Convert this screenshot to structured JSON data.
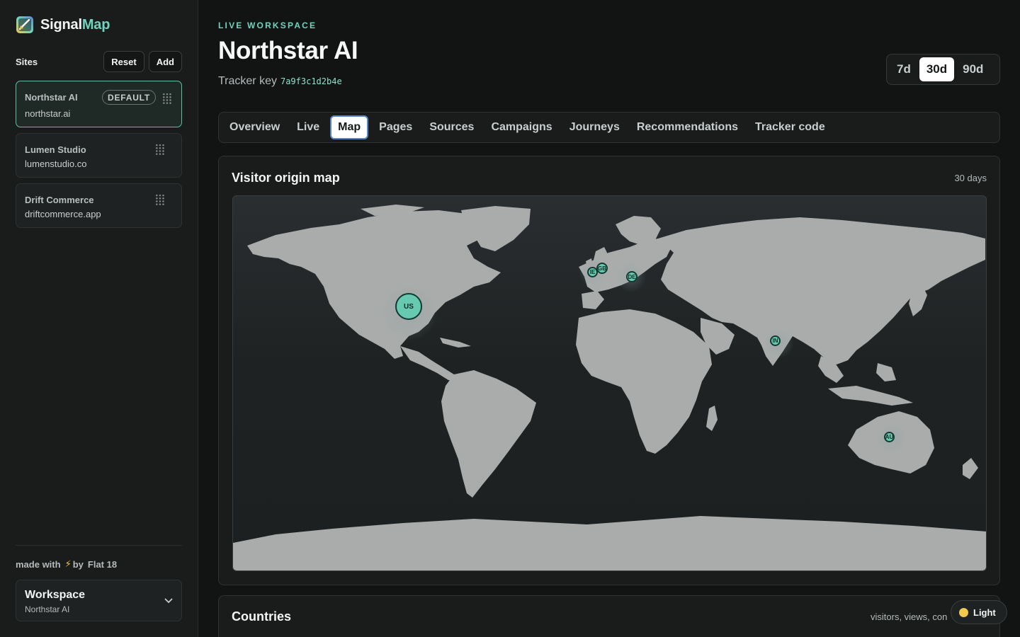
{
  "app": {
    "brand_primary": "Signal",
    "brand_accent": "Map",
    "accent_color": "#6fd3bd"
  },
  "sidebar": {
    "sites_title": "Sites",
    "reset_label": "Reset",
    "add_label": "Add",
    "sites": [
      {
        "name": "Northstar AI",
        "domain": "northstar.ai",
        "badge": "DEFAULT",
        "active": true
      },
      {
        "name": "Lumen Studio",
        "domain": "lumenstudio.co"
      },
      {
        "name": "Drift Commerce",
        "domain": "driftcommerce.app"
      }
    ],
    "made_with_prefix": "made with",
    "made_with_bolt": "⚡",
    "made_with_suffix": "by",
    "made_with_author": "Flat 18",
    "workspace": {
      "title": "Workspace",
      "subtitle": "Northstar AI"
    }
  },
  "header": {
    "eyebrow": "LIVE WORKSPACE",
    "title": "Northstar AI",
    "tracker_label": "Tracker key",
    "tracker_key": "7a9f3c1d2b4e",
    "ranges": [
      {
        "label": "7d",
        "active": false
      },
      {
        "label": "30d",
        "active": true
      },
      {
        "label": "90d",
        "active": false
      }
    ]
  },
  "tabs": [
    {
      "label": "Overview",
      "active": false
    },
    {
      "label": "Live",
      "active": false
    },
    {
      "label": "Map",
      "active": true
    },
    {
      "label": "Pages",
      "active": false
    },
    {
      "label": "Sources",
      "active": false
    },
    {
      "label": "Campaigns",
      "active": false
    },
    {
      "label": "Journeys",
      "active": false
    },
    {
      "label": "Recommendations",
      "active": false
    },
    {
      "label": "Tracker code",
      "active": false
    }
  ],
  "map_panel": {
    "title": "Visitor origin map",
    "meta": "30 days",
    "markers": [
      {
        "code": "US",
        "size": "large"
      },
      {
        "code": "IE",
        "size": "small"
      },
      {
        "code": "GB",
        "size": "small"
      },
      {
        "code": "DE",
        "size": "small"
      },
      {
        "code": "IN",
        "size": "small"
      },
      {
        "code": "AU",
        "size": "small"
      }
    ],
    "land_color": "#a9acab",
    "marker_color": "#66c9b0"
  },
  "countries_panel": {
    "title": "Countries",
    "meta": "visitors, views, con"
  },
  "theme_toggle": {
    "label": "Light",
    "icon": "sun-icon"
  }
}
